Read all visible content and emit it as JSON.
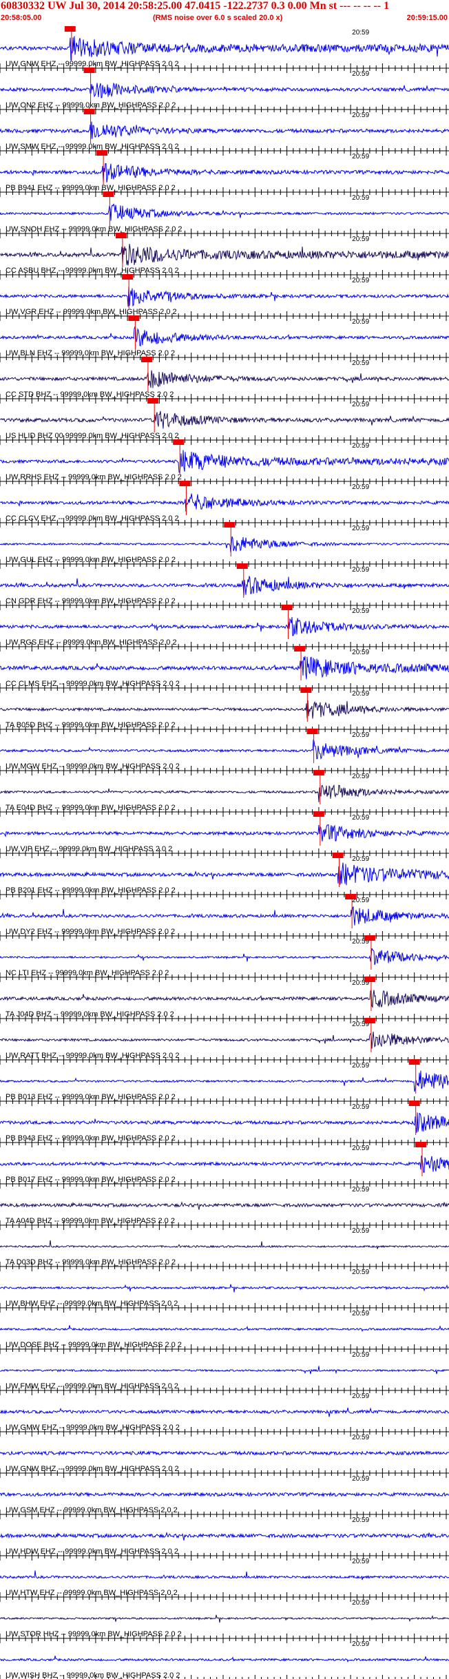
{
  "header": {
    "title": "60830332 UW Jul 30, 2014 20:58:25.00   47.0415 -122.2737  0.3 0.00 Mn st --- --  --  -- 1",
    "start_time": "20:58:05.00",
    "rms_note": "(RMS noise over 6.0 s scaled 20.0 x)",
    "end_time": "20:59:15.00"
  },
  "colors": {
    "title": "#d90000",
    "trace_blue": "#0000ee",
    "trace_dark": "#1a0a5e",
    "pick_box": "#ee0000",
    "pick_line": "#ee0000",
    "axis": "#000000"
  },
  "chart_data": {
    "type": "seismogram",
    "x_range": [
      "20:58:05.00",
      "20:59:15.00"
    ],
    "minute_mark_label": "20:59",
    "traces": [
      {
        "label": "UW GNW EHZ -- 99999.0km BW_HIGHPASS  2.0  2",
        "pick": "20:58:16",
        "color": "blue"
      },
      {
        "label": "UW ON2 EHZ -- 99999.0km BW_HIGHPASS  2.0  2",
        "pick": "20:58:19",
        "color": "blue"
      },
      {
        "label": "UW SMW EHZ -- 99999.0km BW_HIGHPASS  2.0  2",
        "pick": "20:58:19",
        "color": "blue"
      },
      {
        "label": "PB B941 EHZ -- 99999.0km BW_HIGHPASS  2.0  2",
        "pick": "20:58:21",
        "color": "blue"
      },
      {
        "label": "UW SNOH EHZ -- 99999.0km BW_HIGHPASS  2.0  2",
        "pick": "20:58:22",
        "color": "blue"
      },
      {
        "label": "CC ASBU BHZ -- 99999.0km BW_HIGHPASS  2.0  2",
        "pick": "20:58:24",
        "color": "dark"
      },
      {
        "label": "UW VGR EHZ -- 99999.0km BW_HIGHPASS  2.0  2",
        "pick": "20:58:25",
        "color": "blue"
      },
      {
        "label": "UW BLN EHZ -- 99999.0km BW_HIGHPASS  2.0  2",
        "pick": "20:58:26",
        "color": "blue"
      },
      {
        "label": "CC STD BHZ -- 99999.0km BW_HIGHPASS  2.0  2",
        "pick": "20:58:28",
        "color": "dark"
      },
      {
        "label": "US HLID BHZ 00 99999.0km BW_HIGHPASS  2.0  2",
        "pick": "20:58:29",
        "color": "dark"
      },
      {
        "label": "UW RRHS EHZ -- 99999.0km BW_HIGHPASS  2.0  2",
        "pick": "20:58:33",
        "color": "blue"
      },
      {
        "label": "CC CLCV EHZ -- 99999.0km BW_HIGHPASS  2.0  2",
        "pick": "20:58:34",
        "color": "blue"
      },
      {
        "label": "UW GUL EHZ -- 99999.0km BW_HIGHPASS  2.0  2",
        "pick": "20:58:41",
        "color": "blue"
      },
      {
        "label": "CN GDR EHZ -- 99999.0km BW_HIGHPASS  2.0  2",
        "pick": "20:58:43",
        "color": "blue"
      },
      {
        "label": "UW RGS EHZ -- 99999.0km BW_HIGHPASS  2.0  2",
        "pick": "20:58:50",
        "color": "blue"
      },
      {
        "label": "CC CLMS EHZ -- 99999.0km BW_HIGHPASS  2.0  2",
        "pick": "20:58:52",
        "color": "blue"
      },
      {
        "label": "TA B05D BHZ -- 99999.0km BW_HIGHPASS  2.0  2",
        "pick": "20:58:53",
        "color": "dark"
      },
      {
        "label": "UW MGW EHZ -- 99999.0km BW_HIGHPASS  2.0  2",
        "pick": "20:58:54",
        "color": "blue"
      },
      {
        "label": "TA E04D BHZ -- 99999.0km BW_HIGHPASS  2.0  2",
        "pick": "20:58:55",
        "color": "dark"
      },
      {
        "label": "UW VIP EHZ -- 99999.0km BW_HIGHPASS  2.0  2",
        "pick": "20:58:55",
        "color": "blue"
      },
      {
        "label": "PB B201 EHZ -- 99999.0km BW_HIGHPASS  2.0  2",
        "pick": "20:58:58",
        "color": "blue"
      },
      {
        "label": "UW DY2 EHZ -- 99999.0km BW_HIGHPASS  2.0  2",
        "pick": "20:59:00",
        "color": "blue"
      },
      {
        "label": "NC LTI EHZ -- 99999.0km BW_HIGHPASS  2.0  2",
        "pick": "20:59:03",
        "color": "blue"
      },
      {
        "label": "TA J04D BHZ -- 99999.0km BW_HIGHPASS  2.0  2",
        "pick": "20:59:03",
        "color": "dark"
      },
      {
        "label": "UW RATT BHZ -- 99999.0km BW_HIGHPASS  2.0  2",
        "pick": "20:59:03",
        "color": "dark"
      },
      {
        "label": "PB B013 EHZ -- 99999.0km BW_HIGHPASS  2.0  2",
        "pick": "20:59:10",
        "color": "blue"
      },
      {
        "label": "PB B943 EHZ -- 99999.0km BW_HIGHPASS  2.0  2",
        "pick": "20:59:10",
        "color": "blue"
      },
      {
        "label": "PB B017 EHZ -- 99999.0km BW_HIGHPASS  2.0  2",
        "pick": "20:59:11",
        "color": "blue"
      },
      {
        "label": "TA A04D BHZ -- 99999.0km BW_HIGHPASS  2.0  2",
        "pick": null,
        "color": "dark"
      },
      {
        "label": "TA D03D BHZ -- 99999.0km BW_HIGHPASS  2.0  2",
        "pick": null,
        "color": "dark"
      },
      {
        "label": "UW BHW EHZ -- 99999.0km BW_HIGHPASS  2.0  2",
        "pick": null,
        "color": "blue"
      },
      {
        "label": "UW DOSE BHZ -- 99999.0km BW_HIGHPASS  2.0  2",
        "pick": null,
        "color": "blue"
      },
      {
        "label": "UW FMW EHZ -- 99999.0km BW_HIGHPASS  2.0  2",
        "pick": null,
        "color": "blue"
      },
      {
        "label": "UW GMW EHZ -- 99999.0km BW_HIGHPASS  2.0  2",
        "pick": null,
        "color": "blue"
      },
      {
        "label": "UW GNW BHZ -- 99999.0km BW_HIGHPASS  2.0  2",
        "pick": null,
        "color": "blue"
      },
      {
        "label": "UW GSM EHZ -- 99999.0km BW_HIGHPASS  2.0  2",
        "pick": null,
        "color": "blue"
      },
      {
        "label": "UW HDW EHZ -- 99999.0km BW_HIGHPASS  2.0  2",
        "pick": null,
        "color": "blue"
      },
      {
        "label": "UW HTW EHZ -- 99999.0km BW_HIGHPASS  2.0  2",
        "pick": null,
        "color": "blue"
      },
      {
        "label": "UW STOR HHZ -- 99999.0km BW_HIGHPASS  2.0  2",
        "pick": null,
        "color": "dark"
      },
      {
        "label": "UW WISH BHZ -- 99999.0km BW_HIGHPASS  2.0  2",
        "pick": null,
        "color": "blue"
      }
    ]
  }
}
